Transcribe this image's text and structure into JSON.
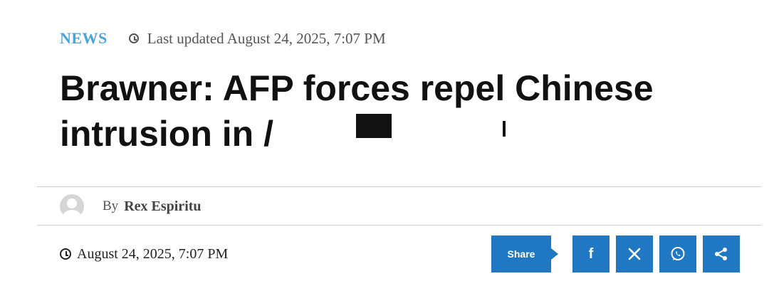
{
  "article": {
    "category": "NEWS",
    "last_updated": "Last updated August 24, 2025, 7:07 PM",
    "headline_line1": "Brawner: AFP forces repel Chinese",
    "headline_line2": "intrusion in /"
  },
  "author": {
    "by_label": "By",
    "name": "Rex Espiritu"
  },
  "publish": {
    "date": "August 24, 2025, 7:07 PM"
  },
  "share": {
    "label": "Share",
    "buttons": [
      {
        "icon": "facebook-icon",
        "glyph": "f"
      },
      {
        "icon": "x-icon",
        "glyph": "𝕏"
      },
      {
        "icon": "whatsapp-icon",
        "glyph": ""
      },
      {
        "icon": "share-icon",
        "glyph": ""
      }
    ]
  },
  "colors": {
    "category": "#4aa3d9",
    "share_button": "#1f78c1"
  }
}
